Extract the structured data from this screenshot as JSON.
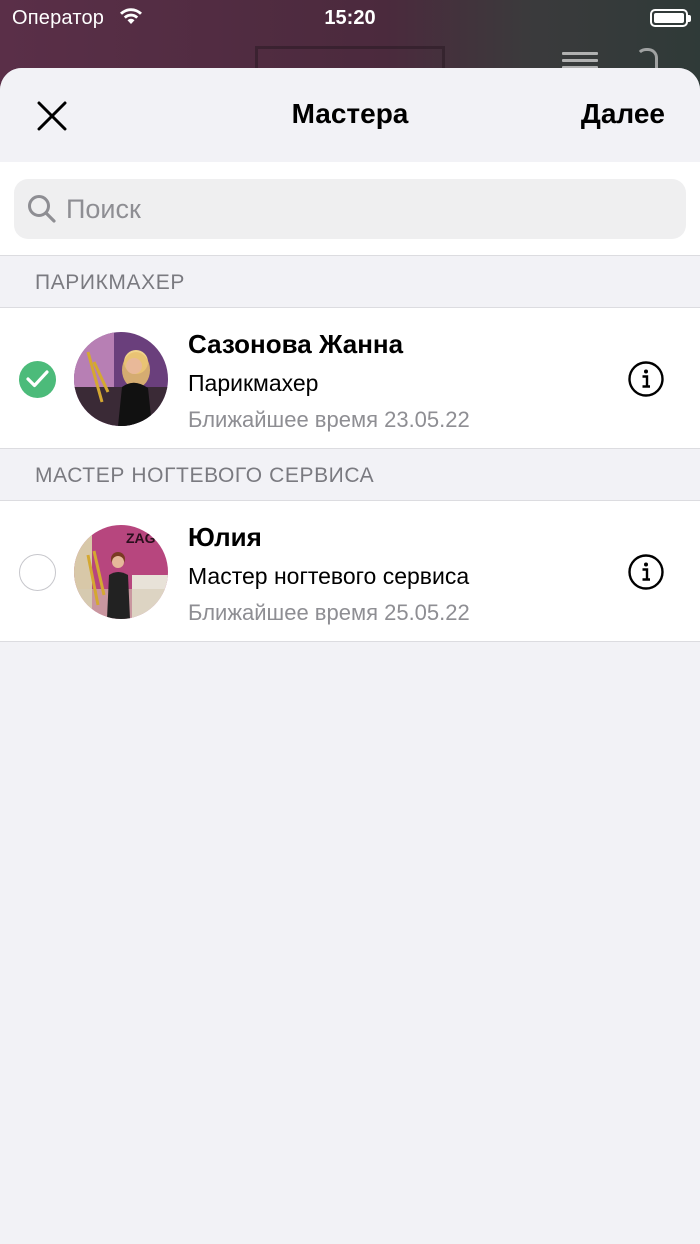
{
  "status_bar": {
    "carrier": "Оператор",
    "time": "15:20"
  },
  "nav": {
    "title": "Мастера",
    "next_label": "Далее"
  },
  "search": {
    "placeholder": "Поиск",
    "value": ""
  },
  "sections": [
    {
      "header": "ПАРИКМАХЕР",
      "masters": [
        {
          "name": "Сазонова Жанна",
          "role": "Парикмахер",
          "next_time": "Ближайшее время 23.05.22",
          "selected": true
        }
      ]
    },
    {
      "header": "МАСТЕР НОГТЕВОГО СЕРВИСА",
      "masters": [
        {
          "name": "Юлия",
          "role": "Мастер ногтевого сервиса",
          "next_time": "Ближайшее время 25.05.22",
          "selected": false
        }
      ]
    }
  ],
  "colors": {
    "selected_check": "#4cbb7a",
    "sheet_background": "#f2f2f6",
    "secondary_text": "#8e8e93"
  },
  "icons": {
    "close": "close-icon",
    "search": "search-icon",
    "info": "info-icon",
    "check": "checkmark-icon",
    "wifi": "wifi-icon",
    "battery": "battery-icon"
  }
}
